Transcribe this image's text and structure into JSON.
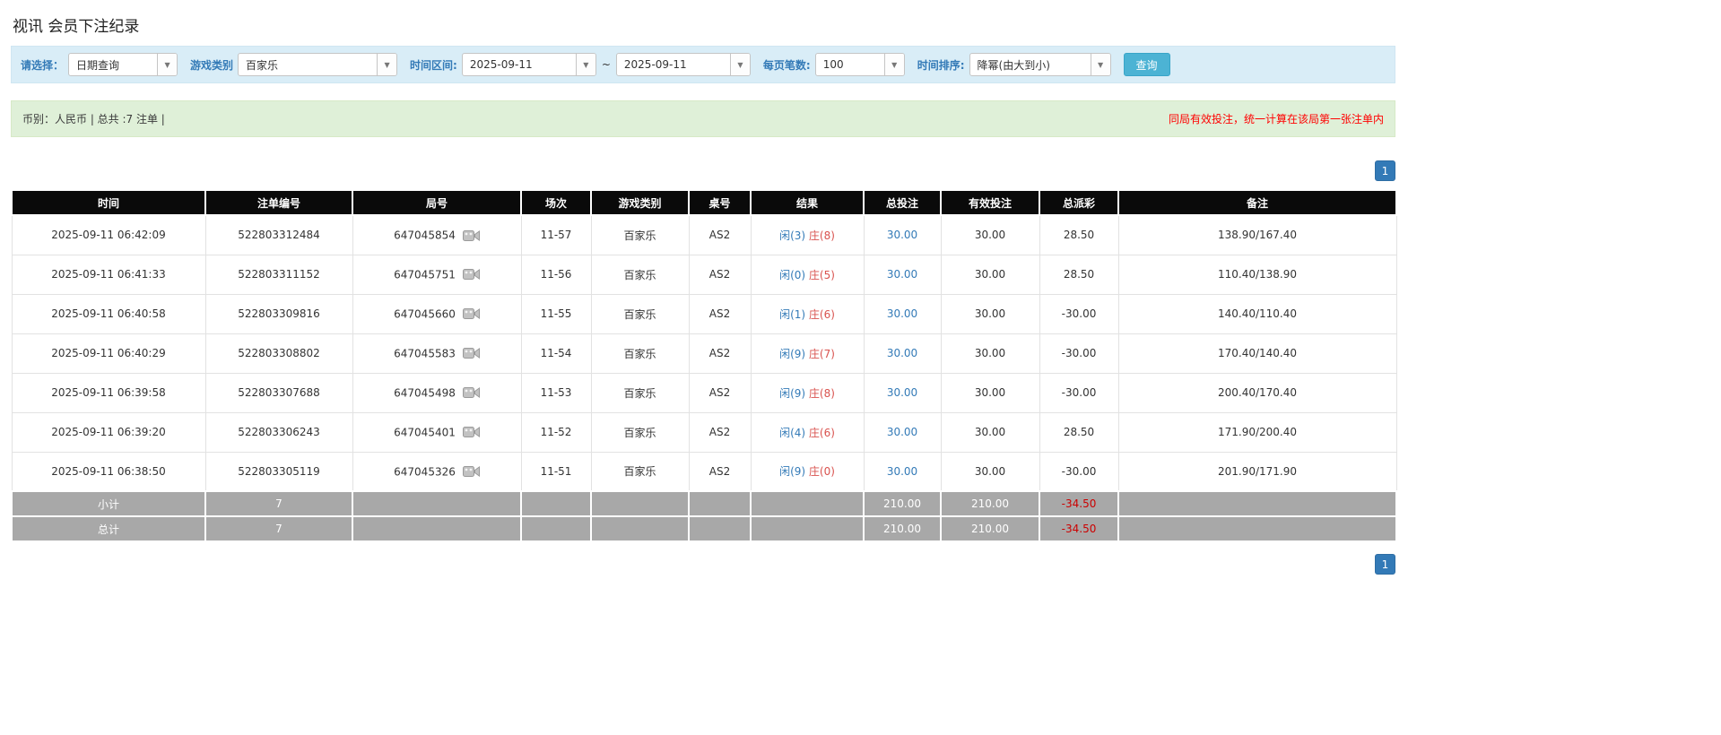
{
  "page": {
    "title": "视讯 会员下注纪录"
  },
  "filters": {
    "select_label": "请选择：",
    "select_value": "日期查询",
    "game_type_label": "游戏类别",
    "game_type_value": "百家乐",
    "date_range_label": "时间区间:",
    "date_from": "2025-09-11",
    "date_separator": "~",
    "date_to": "2025-09-11",
    "page_size_label": "每页笔数:",
    "page_size_value": "100",
    "sort_label": "时间排序:",
    "sort_value": "降幂(由大到小)",
    "search_button": "查询"
  },
  "summary": {
    "left_text": "币别：人民币 | 总共 :7 注单 |",
    "right_text": "同局有效投注，统一计算在该局第一张注单内"
  },
  "pagination": {
    "page": "1"
  },
  "table": {
    "headers": [
      "时间",
      "注单编号",
      "局号",
      "场次",
      "游戏类别",
      "桌号",
      "结果",
      "总投注",
      "有效投注",
      "总派彩",
      "备注"
    ],
    "rows": [
      {
        "time": "2025-09-11 06:42:09",
        "bet_id": "522803312484",
        "round_id": "647045854",
        "session": "11-57",
        "game": "百家乐",
        "table_no": "AS2",
        "result_player": "闲(3)",
        "result_banker": "庄(8)",
        "total_bet": "30.00",
        "valid_bet": "30.00",
        "payout": "28.50",
        "note": "138.90/167.40"
      },
      {
        "time": "2025-09-11 06:41:33",
        "bet_id": "522803311152",
        "round_id": "647045751",
        "session": "11-56",
        "game": "百家乐",
        "table_no": "AS2",
        "result_player": "闲(0)",
        "result_banker": "庄(5)",
        "total_bet": "30.00",
        "valid_bet": "30.00",
        "payout": "28.50",
        "note": "110.40/138.90"
      },
      {
        "time": "2025-09-11 06:40:58",
        "bet_id": "522803309816",
        "round_id": "647045660",
        "session": "11-55",
        "game": "百家乐",
        "table_no": "AS2",
        "result_player": "闲(1)",
        "result_banker": "庄(6)",
        "total_bet": "30.00",
        "valid_bet": "30.00",
        "payout": "-30.00",
        "note": "140.40/110.40"
      },
      {
        "time": "2025-09-11 06:40:29",
        "bet_id": "522803308802",
        "round_id": "647045583",
        "session": "11-54",
        "game": "百家乐",
        "table_no": "AS2",
        "result_player": "闲(9)",
        "result_banker": "庄(7)",
        "total_bet": "30.00",
        "valid_bet": "30.00",
        "payout": "-30.00",
        "note": "170.40/140.40"
      },
      {
        "time": "2025-09-11 06:39:58",
        "bet_id": "522803307688",
        "round_id": "647045498",
        "session": "11-53",
        "game": "百家乐",
        "table_no": "AS2",
        "result_player": "闲(9)",
        "result_banker": "庄(8)",
        "total_bet": "30.00",
        "valid_bet": "30.00",
        "payout": "-30.00",
        "note": "200.40/170.40"
      },
      {
        "time": "2025-09-11 06:39:20",
        "bet_id": "522803306243",
        "round_id": "647045401",
        "session": "11-52",
        "game": "百家乐",
        "table_no": "AS2",
        "result_player": "闲(4)",
        "result_banker": "庄(6)",
        "total_bet": "30.00",
        "valid_bet": "30.00",
        "payout": "28.50",
        "note": "171.90/200.40"
      },
      {
        "time": "2025-09-11 06:38:50",
        "bet_id": "522803305119",
        "round_id": "647045326",
        "session": "11-51",
        "game": "百家乐",
        "table_no": "AS2",
        "result_player": "闲(9)",
        "result_banker": "庄(0)",
        "total_bet": "30.00",
        "valid_bet": "30.00",
        "payout": "-30.00",
        "note": "201.90/171.90"
      }
    ],
    "subtotal": {
      "label": "小计",
      "count": "7",
      "total_bet": "210.00",
      "valid_bet": "210.00",
      "payout": "-34.50"
    },
    "total": {
      "label": "总计",
      "count": "7",
      "total_bet": "210.00",
      "valid_bet": "210.00",
      "payout": "-34.50"
    }
  }
}
